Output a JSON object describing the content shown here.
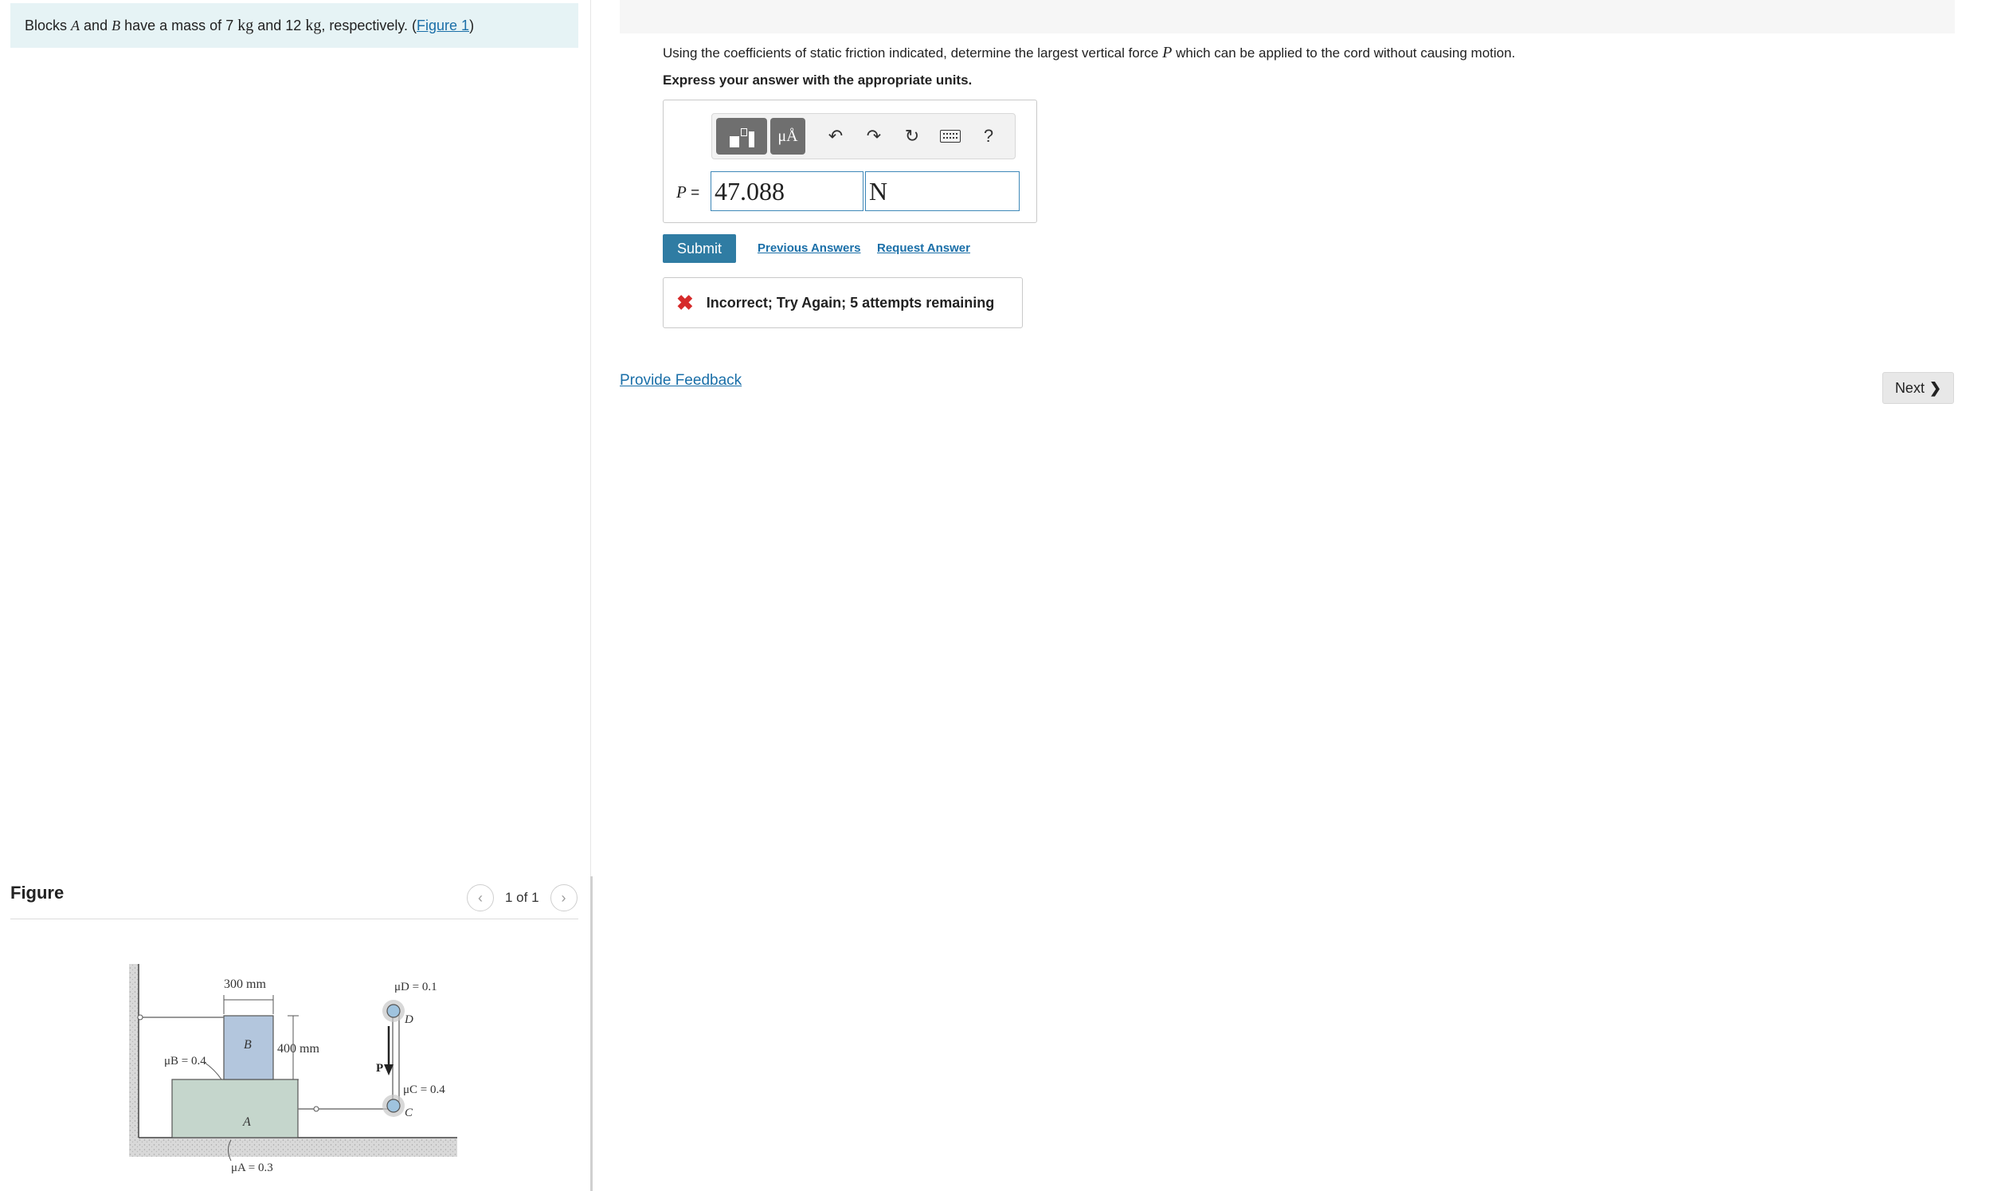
{
  "problem": {
    "prefix": "Blocks",
    "block_a": "A",
    "and1": "and",
    "block_b": "B",
    "mid": "have a mass of 7",
    "unit1": "kg",
    "and2": "and 12",
    "unit2": "kg",
    "suffix": ", respectively. (",
    "figure_link": "Figure 1",
    "close": ")"
  },
  "figure": {
    "heading": "Figure",
    "counter": "1 of 1",
    "prev_icon": "chevron-left-icon",
    "next_icon": "chevron-right-icon",
    "labels": {
      "dim_width": "300 mm",
      "dim_height": "400 mm",
      "mu_d": "μD = 0.1",
      "mu_b": "μB = 0.4",
      "mu_c": "μC = 0.4",
      "mu_a": "μA = 0.3",
      "block_b": "B",
      "block_a": "A",
      "pulley_d": "D",
      "pulley_c": "C",
      "force": "P"
    }
  },
  "question": {
    "before": "Using the coefficients of static friction indicated, determine the largest vertical force",
    "variable": "P",
    "after": "which can be applied to the cord without causing motion.",
    "instruction": "Express your answer with the appropriate units."
  },
  "answer": {
    "variable": "P",
    "equals": "=",
    "value": "47.088",
    "unit": "N",
    "toolbar": {
      "tile2_text": "μÅ",
      "undo_icon": "undo-icon",
      "redo_icon": "redo-icon",
      "reset_icon": "reset-icon",
      "keyboard_icon": "keyboard-icon",
      "help": "?"
    }
  },
  "actions": {
    "submit": "Submit",
    "previous_answers": "Previous Answers",
    "request_answer": "Request Answer"
  },
  "feedback": {
    "icon": "✖",
    "text": "Incorrect; Try Again; 5 attempts remaining"
  },
  "footer": {
    "provide_feedback": "Provide Feedback",
    "next": "Next"
  },
  "colors": {
    "problem_bg": "#e6f3f5",
    "accent": "#2f7ca3",
    "link": "#1a6fa8",
    "error": "#d62b2b",
    "block_b": "#b3c6dd",
    "block_a": "#c5d6cc"
  }
}
